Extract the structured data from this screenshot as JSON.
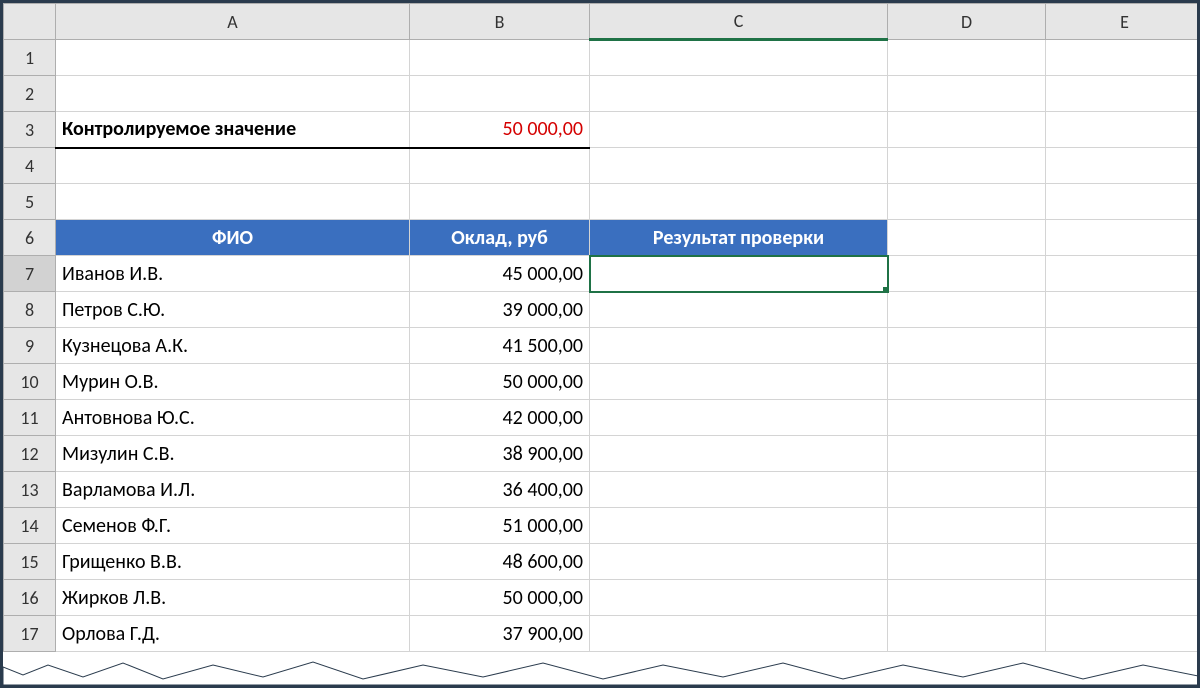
{
  "columns": [
    "A",
    "B",
    "C",
    "D",
    "E"
  ],
  "row_numbers": [
    1,
    2,
    3,
    4,
    5,
    6,
    7,
    8,
    9,
    10,
    11,
    12,
    13,
    14,
    15,
    16,
    17
  ],
  "control": {
    "label": "Контролируемое значение",
    "value": "50 000,00"
  },
  "table_headers": {
    "name": "ФИО",
    "salary": "Оклад, руб",
    "result": "Результат проверки"
  },
  "rows": [
    {
      "name": "Иванов И.В.",
      "salary": "45 000,00"
    },
    {
      "name": "Петров С.Ю.",
      "salary": "39 000,00"
    },
    {
      "name": "Кузнецова А.К.",
      "salary": "41 500,00"
    },
    {
      "name": "Мурин О.В.",
      "salary": "50 000,00"
    },
    {
      "name": "Антовнова Ю.С.",
      "salary": "42 000,00"
    },
    {
      "name": "Мизулин С.В.",
      "salary": "38 900,00"
    },
    {
      "name": "Варламова И.Л.",
      "salary": "36 400,00"
    },
    {
      "name": "Семенов Ф.Г.",
      "salary": "51 000,00"
    },
    {
      "name": "Грищенко В.В.",
      "salary": "48 600,00"
    },
    {
      "name": "Жирков Л.В.",
      "salary": "50 000,00"
    },
    {
      "name": "Орлова Г.Д.",
      "salary": "37 900,00"
    }
  ],
  "active_cell": "C7"
}
